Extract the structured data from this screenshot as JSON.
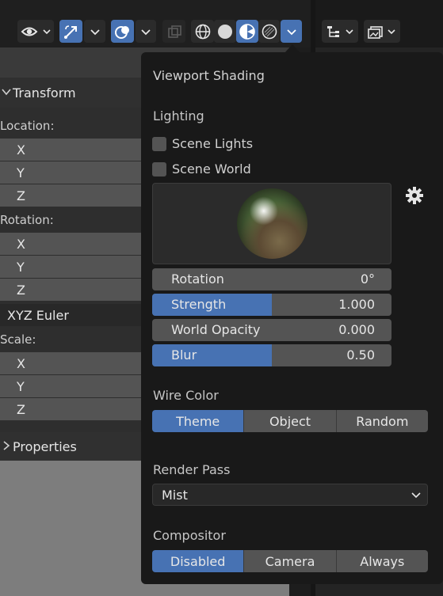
{
  "header": {
    "buttons": [
      {
        "icon": "eye-visibility-icon",
        "active": false
      },
      {
        "icon": "gizmo-arrow-icon",
        "active": true
      },
      {
        "icon": "overlay-spheres-icon",
        "active": true
      },
      {
        "icon": "xray-icon",
        "active": false
      },
      {
        "icon": "wireframe-shading-icon",
        "active": false
      },
      {
        "icon": "solid-shading-icon",
        "active": false
      },
      {
        "icon": "material-preview-shading-icon",
        "active": true
      },
      {
        "icon": "rendered-shading-icon",
        "active": false
      },
      {
        "icon": "shading-dropdown-chevron-icon",
        "active": true
      }
    ],
    "right_buttons": [
      {
        "icon": "outliner-tree-icon"
      },
      {
        "icon": "image-display-icon"
      }
    ]
  },
  "npanel": {
    "transform_header": "Transform",
    "location_label": "Location:",
    "location_fields": [
      "X",
      "Y",
      "Z"
    ],
    "rotation_label": "Rotation:",
    "rotation_fields": [
      "X",
      "Y",
      "Z"
    ],
    "rotation_mode": "XYZ Euler",
    "scale_label": "Scale:",
    "scale_fields": [
      "X",
      "Y",
      "Z"
    ],
    "properties_header": "Properties"
  },
  "popover": {
    "title": "Viewport Shading",
    "lighting": {
      "label": "Lighting",
      "scene_lights": "Scene Lights",
      "scene_world": "Scene World",
      "sliders": [
        {
          "label": "Rotation",
          "value": "0°",
          "fill": 0
        },
        {
          "label": "Strength",
          "value": "1.000",
          "fill": 0.5
        },
        {
          "label": "World Opacity",
          "value": "0.000",
          "fill": 0
        },
        {
          "label": "Blur",
          "value": "0.50",
          "fill": 0.5
        }
      ]
    },
    "wire_color": {
      "label": "Wire Color",
      "options": [
        "Theme",
        "Object",
        "Random"
      ],
      "selected": "Theme"
    },
    "render_pass": {
      "label": "Render Pass",
      "value": "Mist"
    },
    "compositor": {
      "label": "Compositor",
      "options": [
        "Disabled",
        "Camera",
        "Always"
      ],
      "selected": "Disabled"
    }
  },
  "colors": {
    "accent": "#4772b3",
    "field": "#545454",
    "popover_bg": "#191919"
  }
}
